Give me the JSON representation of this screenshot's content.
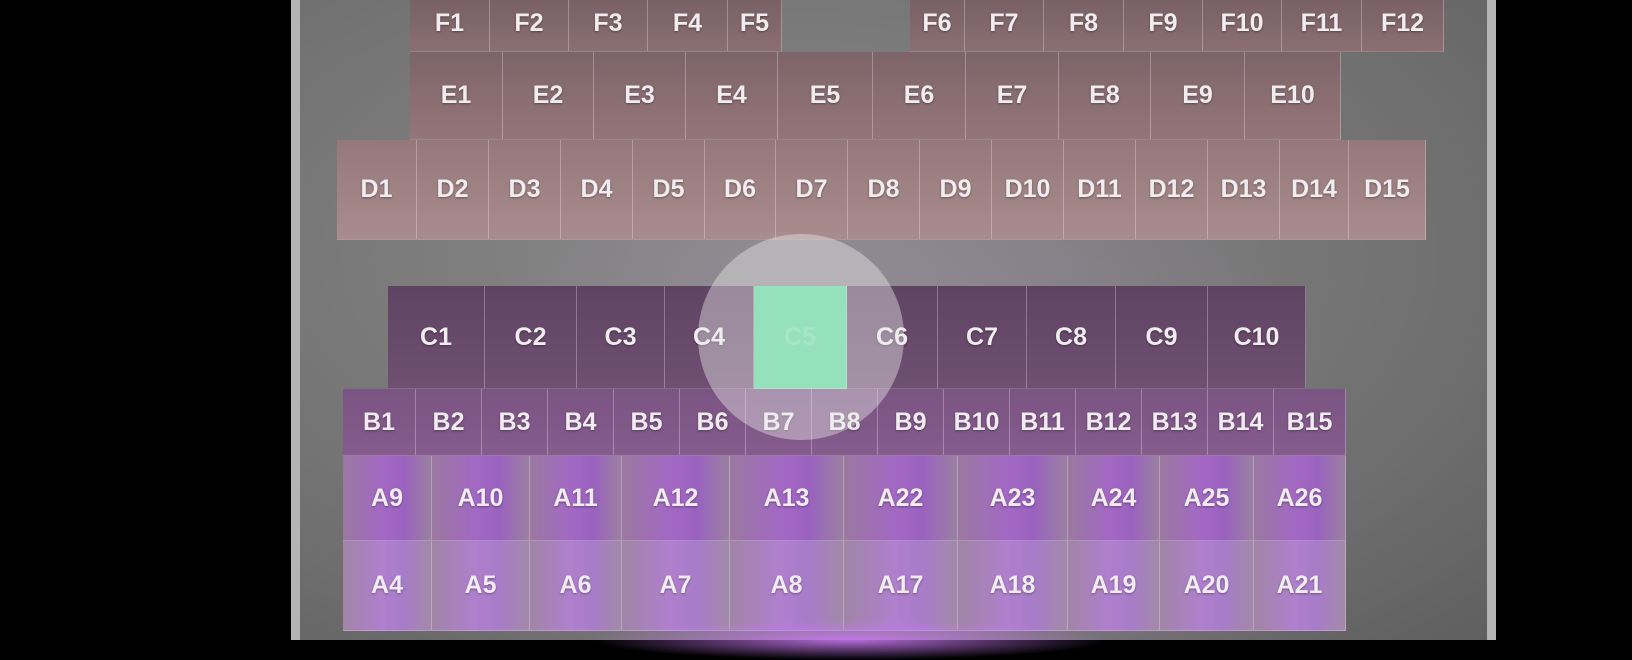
{
  "colors": {
    "background": "#000000",
    "frame": "#b4b4b4",
    "floor": "#7a7a7a",
    "selected_seat": "#57d99a",
    "seat_text": "#f1ecef"
  },
  "selected_seat": "C5",
  "rows": {
    "F": [
      "F1",
      "F2",
      "F3",
      "F4",
      "F5",
      "F6",
      "F7",
      "F8",
      "F9",
      "F10",
      "F11",
      "F12"
    ],
    "E": [
      "E1",
      "E2",
      "E3",
      "E4",
      "E5",
      "E6",
      "E7",
      "E8",
      "E9",
      "E10"
    ],
    "D": [
      "D1",
      "D2",
      "D3",
      "D4",
      "D5",
      "D6",
      "D7",
      "D8",
      "D9",
      "D10",
      "D11",
      "D12",
      "D13",
      "D14",
      "D15"
    ],
    "C": [
      "C1",
      "C2",
      "C3",
      "C4",
      "C5",
      "C6",
      "C7",
      "C8",
      "C9",
      "C10"
    ],
    "B": [
      "B1",
      "B2",
      "B3",
      "B4",
      "B5",
      "B6",
      "B7",
      "B8",
      "B9",
      "B10",
      "B11",
      "B12",
      "B13",
      "B14",
      "B15"
    ],
    "A_upper": [
      "A9",
      "A10",
      "A11",
      "A12",
      "A13",
      "A22",
      "A23",
      "A24",
      "A25",
      "A26"
    ],
    "A_lower": [
      "A4",
      "A5",
      "A6",
      "A7",
      "A8",
      "A17",
      "A18",
      "A19",
      "A20",
      "A21"
    ]
  }
}
